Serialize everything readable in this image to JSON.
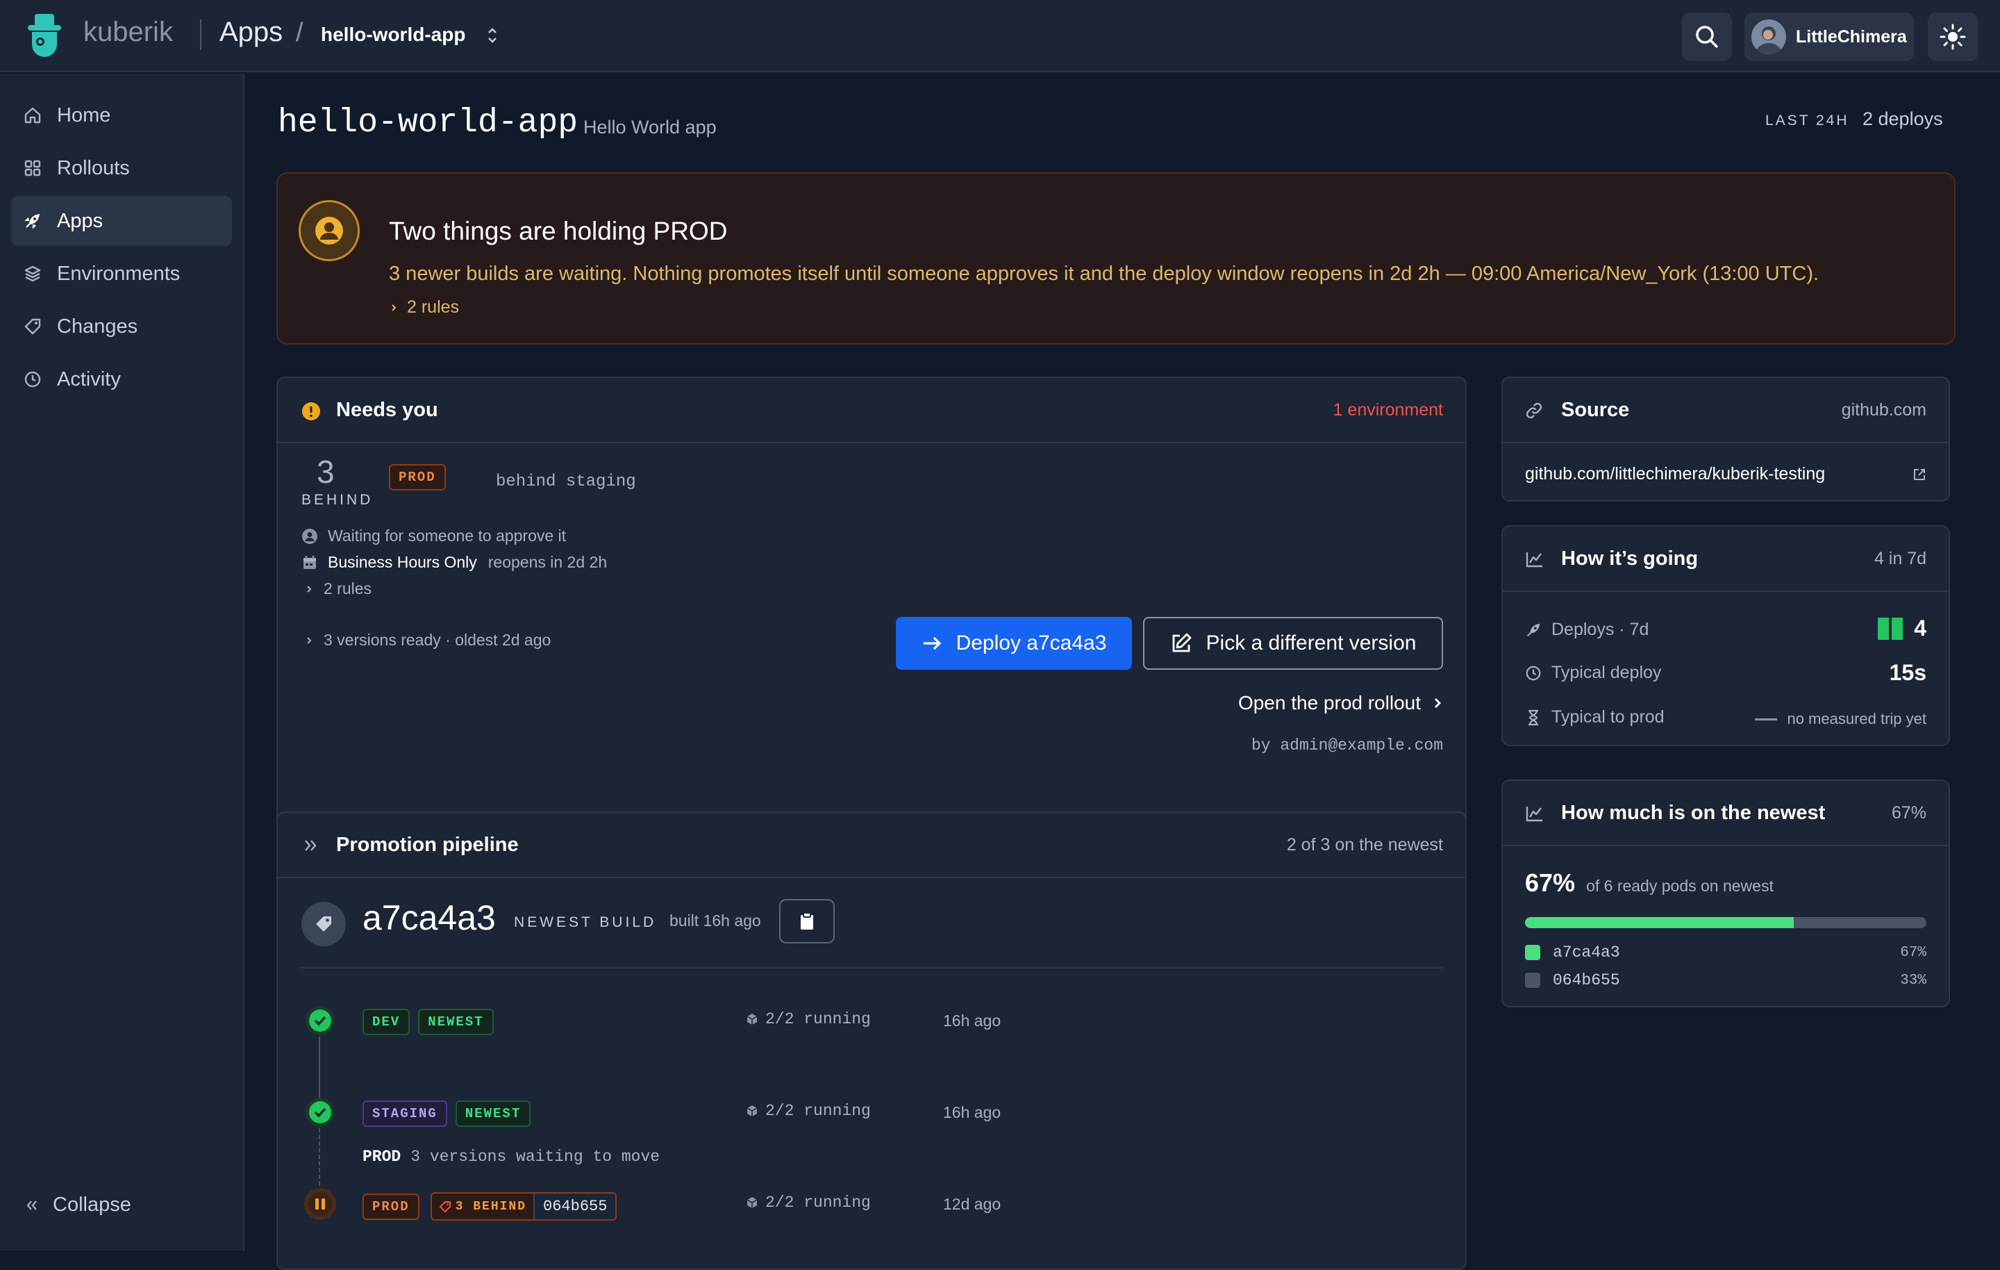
{
  "topbar": {
    "brand": "kuberik",
    "crumb_apps": "Apps",
    "crumb_slash": "/",
    "crumb_app": "hello-world-app",
    "user_name": "LittleChimera"
  },
  "sidebar": {
    "items": [
      {
        "label": "Home",
        "icon": "home-icon"
      },
      {
        "label": "Rollouts",
        "icon": "grid-icon"
      },
      {
        "label": "Apps",
        "icon": "rocket-icon",
        "active": true
      },
      {
        "label": "Environments",
        "icon": "layers-icon"
      },
      {
        "label": "Changes",
        "icon": "tag-icon"
      },
      {
        "label": "Activity",
        "icon": "clock-icon"
      }
    ],
    "collapse_label": "Collapse"
  },
  "header": {
    "title": "hello-world-app",
    "subtitle": "Hello World app",
    "last_label": "LAST 24H",
    "deploys": "2 deploys"
  },
  "alert": {
    "title": "Two things are holding PROD",
    "text": "3 newer builds are waiting. Nothing promotes itself until someone approves it and the deploy window reopens in 2d 2h — 09:00 America/New_York (13:00 UTC).",
    "rules": "2 rules"
  },
  "needs_you": {
    "title": "Needs you",
    "meta": "1 environment",
    "behind_count": "3",
    "behind_label": "BEHIND",
    "env_badge": "PROD",
    "behind_text": "behind staging",
    "waiting": "Waiting for someone to approve it",
    "window_name": "Business Hours Only",
    "window_reopens": "reopens in 2d 2h",
    "rules": "2 rules",
    "versions_ready": "3 versions ready · oldest 2d ago",
    "deploy_button": "Deploy a7ca4a3",
    "pick_button": "Pick a different version",
    "open_rollout": "Open the prod rollout",
    "by": "by admin@example.com"
  },
  "pipeline": {
    "title": "Promotion pipeline",
    "meta": "2 of 3 on the newest",
    "build": "a7ca4a3",
    "build_label": "NEWEST BUILD",
    "built": "built 16h ago",
    "stages": [
      {
        "env": "DEV",
        "tag": "NEWEST",
        "running": "2/2 running",
        "ago": "16h ago"
      },
      {
        "env": "STAGING",
        "tag": "NEWEST",
        "running": "2/2 running",
        "ago": "16h ago"
      },
      {
        "env": "PROD",
        "behind": "3 BEHIND",
        "version": "064b655",
        "running": "2/2 running",
        "ago": "12d ago"
      }
    ],
    "waiting_env": "PROD",
    "waiting_text": "3 versions waiting to move"
  },
  "source": {
    "title": "Source",
    "meta": "github.com",
    "link": "github.com/littlechimera/kuberik-testing"
  },
  "going": {
    "title": "How it’s going",
    "meta": "4 in 7d",
    "deploys_label": "Deploys · 7d",
    "deploys_value": "4",
    "typical_deploy_label": "Typical deploy",
    "typical_deploy_value": "15s",
    "typical_prod_label": "Typical to prod",
    "typical_prod_value": "no measured trip yet"
  },
  "newest": {
    "title": "How much is on the newest",
    "meta": "67%",
    "percent": "67%",
    "text": "of 6 ready pods on newest",
    "fraction": 0.67,
    "versions": [
      {
        "name": "a7ca4a3",
        "pct": "67%",
        "color": "#4ade80"
      },
      {
        "name": "064b655",
        "pct": "33%",
        "color": "#4b5563"
      }
    ]
  },
  "colors": {
    "accent": "#1764f2",
    "success": "#22c55e",
    "warning": "#f0a020",
    "danger": "#f0524a"
  }
}
